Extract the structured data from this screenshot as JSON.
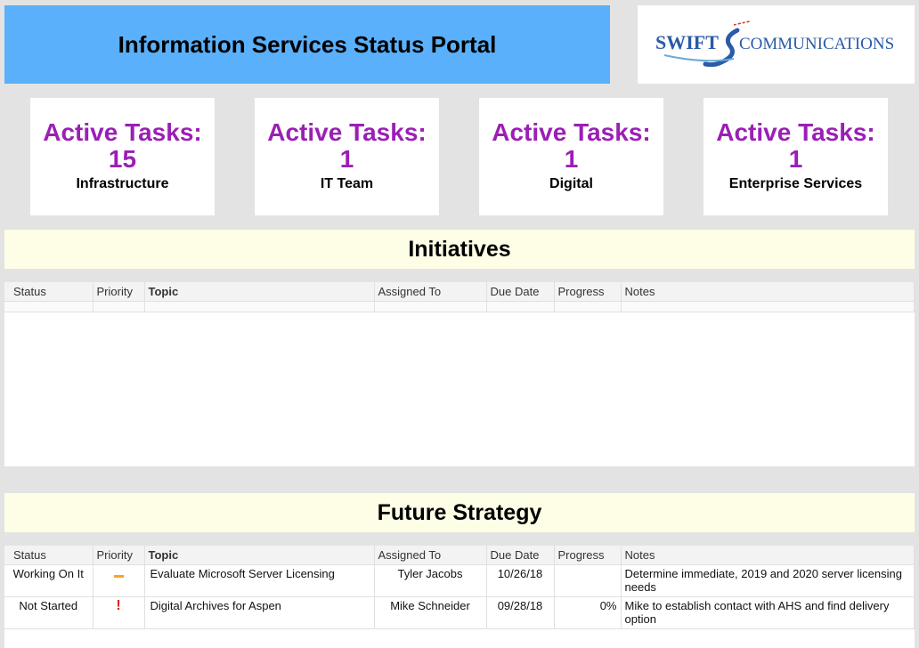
{
  "header": {
    "title": "Information Services Status Portal",
    "logo_text_1": "SWIFT",
    "logo_text_2": "COMMUNICATIONS"
  },
  "cards": [
    {
      "label": "Active Tasks:",
      "count": "15",
      "team": "Infrastructure"
    },
    {
      "label": "Active Tasks:",
      "count": "1",
      "team": "IT Team"
    },
    {
      "label": "Active Tasks:",
      "count": "1",
      "team": "Digital"
    },
    {
      "label": "Active Tasks:",
      "count": "1",
      "team": "Enterprise Services"
    }
  ],
  "columns": [
    "Status",
    "Priority",
    "Topic",
    "Assigned To",
    "Due Date",
    "Progress",
    "Notes"
  ],
  "initiatives": {
    "title": "Initiatives",
    "rows": []
  },
  "future": {
    "title": "Future Strategy",
    "rows": [
      {
        "status": "Working On It",
        "priority": "medium-dash-icon",
        "topic": "Evaluate Microsoft Server Licensing",
        "assigned": "Tyler Jacobs",
        "due": "10/26/18",
        "progress": "",
        "notes": "Determine immediate, 2019 and 2020 server licensing needs"
      },
      {
        "status": "Not Started",
        "priority": "high-exclamation-icon",
        "topic": "Digital Archives for Aspen",
        "assigned": "Mike Schneider",
        "due": "09/28/18",
        "progress": "0%",
        "notes": "Mike to establish contact with AHS and find delivery option"
      }
    ]
  },
  "colors": {
    "title_bar": "#5ab0fa",
    "card_accent": "#9b1fb5",
    "section_header": "#fefee6",
    "priority_medium": "#f5a623",
    "priority_high": "#e02020"
  }
}
